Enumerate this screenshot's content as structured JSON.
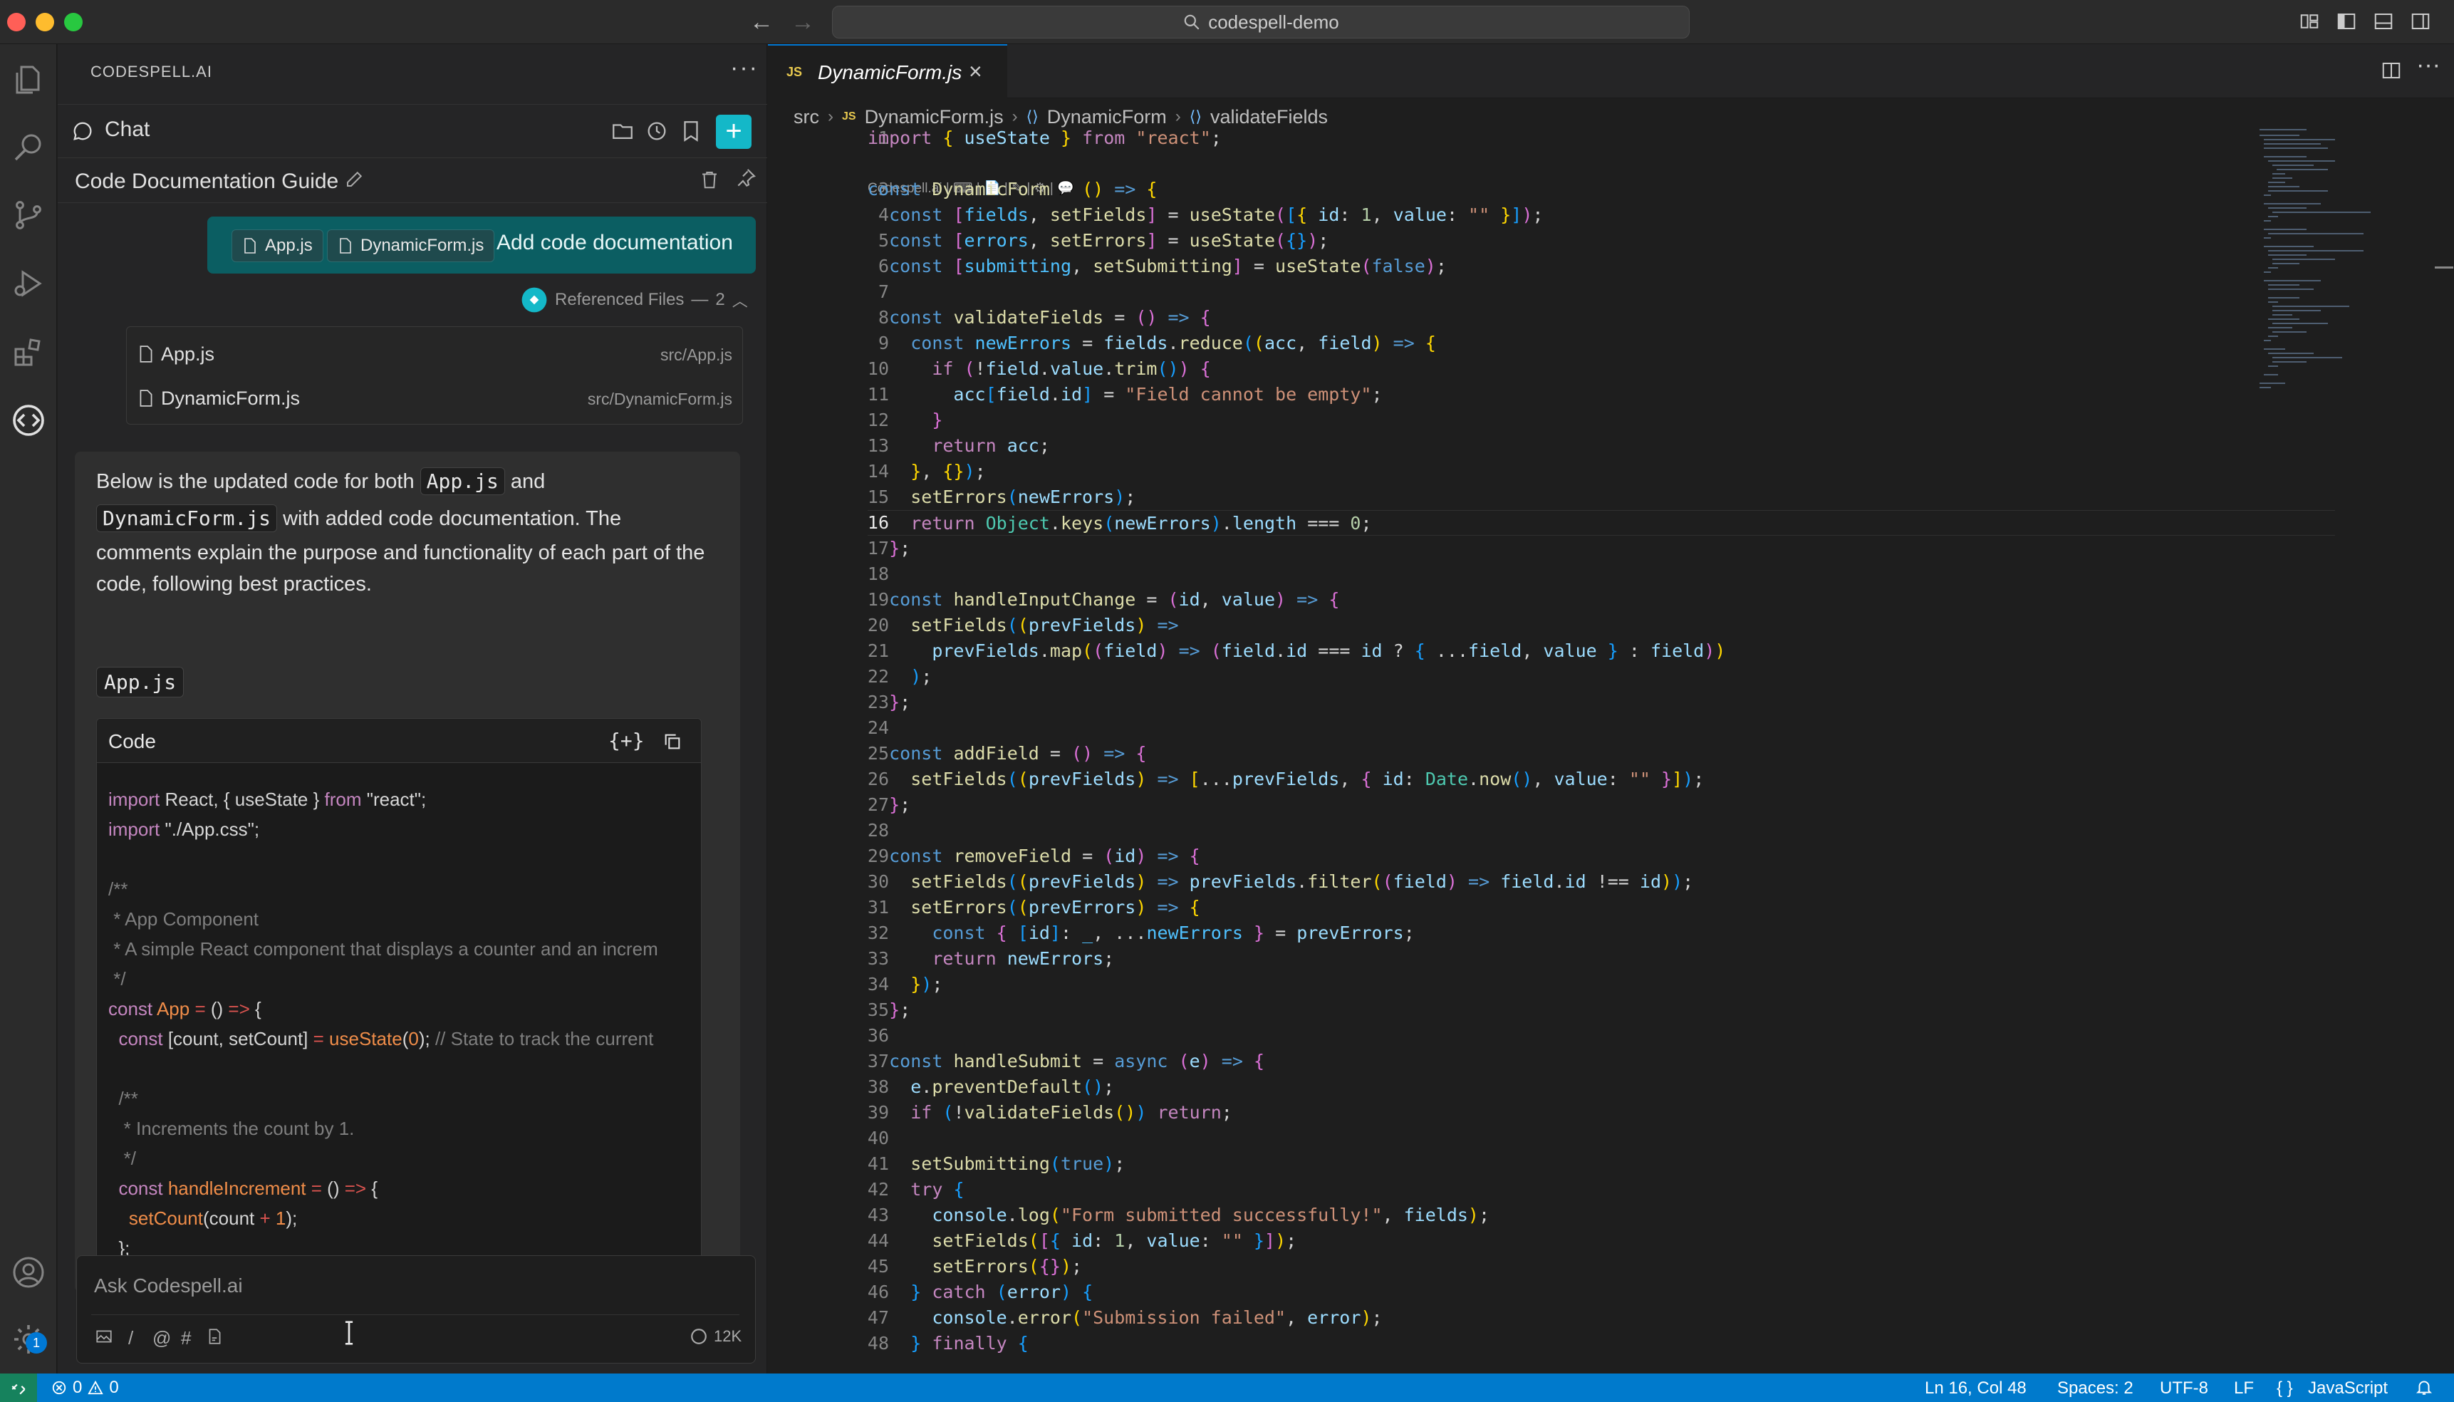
{
  "window": {
    "search_title": "codespell-demo"
  },
  "sidebar_panel": {
    "title": "CODESPELL.AI",
    "more_label": "···",
    "chat_label": "Chat",
    "new_chat_label": "+",
    "conversation_title": "Code Documentation Guide",
    "user_message": {
      "files": [
        "App.js",
        "DynamicForm.js"
      ],
      "text": "Add code documentation"
    },
    "referenced_files": {
      "label": "Referenced Files",
      "dash": "—",
      "count": "2",
      "items": [
        {
          "name": "App.js",
          "path": "src/App.js"
        },
        {
          "name": "DynamicForm.js",
          "path": "src/DynamicForm.js"
        }
      ]
    },
    "answer": {
      "intro_1": "Below is the updated code for both",
      "code_app": "App.js",
      "and": "and",
      "code_dynform": "DynamicForm.js",
      "intro_2": "with added code documentation. The",
      "intro_3": "comments explain the purpose and functionality of each part of the code, following best practices.",
      "file_badge": "App.js",
      "code_block_title": "Code",
      "code_block_insert": "{+}"
    },
    "input": {
      "placeholder": "Ask Codespell.ai",
      "tools": [
        "/",
        "@",
        "#"
      ],
      "token_count": "12K"
    }
  },
  "editor": {
    "tab": {
      "badge": "JS",
      "name": "DynamicForm.js",
      "close": "×"
    },
    "breadcrumb": [
      "src",
      "DynamicForm.js",
      "DynamicForm",
      "validateFields"
    ],
    "breadcrumb_js_badge": "JS",
    "codelens": "Codespell.ai | ⌨ | 📄 | ✎ | ⚙ | 💬",
    "line_numbers": [
      "1",
      "",
      "3",
      "4",
      "5",
      "6",
      "7",
      "8",
      "9",
      "10",
      "11",
      "12",
      "13",
      "14",
      "15",
      "16",
      "17",
      "18",
      "19",
      "20",
      "21",
      "22",
      "23",
      "24",
      "25",
      "26",
      "27",
      "28",
      "29",
      "30",
      "31",
      "32",
      "33",
      "34",
      "35",
      "36",
      "37",
      "38",
      "39",
      "40",
      "41",
      "42",
      "43",
      "44",
      "45",
      "46",
      "47",
      "48"
    ],
    "current_line": "16"
  },
  "statusbar": {
    "errors": "0",
    "warnings": "0",
    "position": "Ln 16, Col 48",
    "spaces": "Spaces: 2",
    "encoding": "UTF-8",
    "eol": "LF",
    "language_icon": "{ }",
    "language": "JavaScript"
  },
  "activity_bar": {
    "settings_badge": "1"
  },
  "colors": {
    "accent": "#0078d4",
    "brand_teal": "#14b8c8",
    "user_bubble": "#0b5e62",
    "statusbar": "#007acc"
  }
}
